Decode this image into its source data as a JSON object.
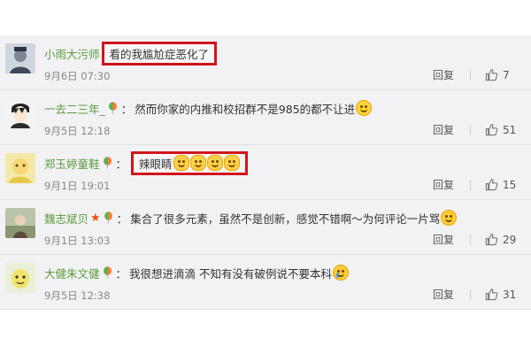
{
  "comments": [
    {
      "username": "小雨大污师",
      "text": "看的我尴尬症恶化了",
      "time": "9月6日 07:30",
      "reply_label": "回复",
      "likes": "7",
      "highlighted": true,
      "badge": false,
      "emoji": []
    },
    {
      "username": "一去二三年_",
      "text": "然而你家的内推和校招群不是985的都不让进",
      "time": "9月5日 12:18",
      "reply_label": "回复",
      "likes": "51",
      "highlighted": false,
      "badge": true,
      "emoji": [
        "smile-emoji"
      ]
    },
    {
      "username": "郑玉婷童鞋",
      "text": "辣眼睛",
      "time": "9月1日 19:01",
      "reply_label": "回复",
      "likes": "15",
      "highlighted": true,
      "badge": true,
      "emoji": [
        "cat-emoji",
        "cat-emoji",
        "cat-emoji",
        "cat-emoji"
      ]
    },
    {
      "username": "魏志斌贝",
      "text": "集合了很多元素，虽然不是创新，感觉不错啊～为何评论一片骂",
      "time": "9月1日 13:03",
      "reply_label": "回复",
      "likes": "29",
      "highlighted": false,
      "badge": true,
      "vip": true,
      "emoji": [
        "laugh-emoji"
      ]
    },
    {
      "username": "大健朱文健",
      "text": "我很想进滴滴 不知有没有破例说不要本科",
      "time": "9月5日 12:38",
      "reply_label": "回复",
      "likes": "31",
      "highlighted": false,
      "badge": true,
      "emoji": [
        "cry-emoji"
      ]
    }
  ],
  "colors": {
    "username": "#5a9b3a",
    "highlight_border": "#d2141b",
    "background": "#f2f2f5"
  },
  "icons": {
    "like": "thumbs-up-icon",
    "badge": "balloon-badge-icon",
    "vip": "star-icon"
  }
}
